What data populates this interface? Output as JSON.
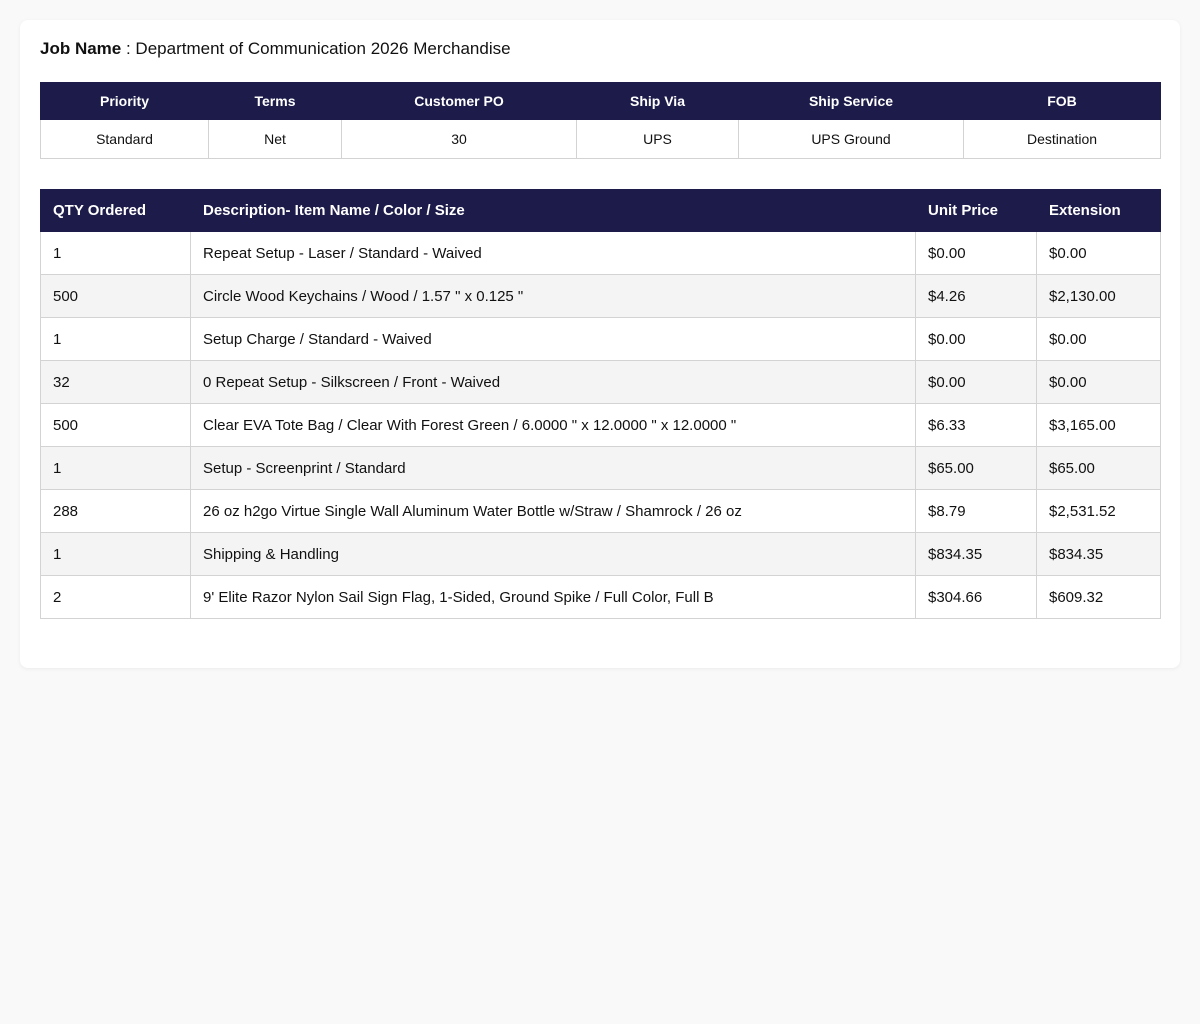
{
  "job": {
    "label": "Job Name",
    "separator": " : ",
    "value": "Department of Communication 2026 Merchandise"
  },
  "info_table": {
    "headers": [
      "Priority",
      "Terms",
      "Customer PO",
      "Ship Via",
      "Ship Service",
      "FOB"
    ],
    "values": [
      "Standard",
      "Net",
      "30",
      "UPS",
      "UPS Ground",
      "Destination"
    ]
  },
  "items_table": {
    "headers": [
      "QTY Ordered",
      "Description- Item Name / Color / Size",
      "Unit Price",
      "Extension"
    ],
    "rows": [
      [
        "1",
        "Repeat Setup - Laser / Standard - Waived",
        "$0.00",
        "$0.00"
      ],
      [
        "500",
        "Circle Wood Keychains / Wood / 1.57 \" x 0.125 \"",
        "$4.26",
        "$2,130.00"
      ],
      [
        "1",
        "Setup Charge / Standard - Waived",
        "$0.00",
        "$0.00"
      ],
      [
        "32",
        "0 Repeat Setup - Silkscreen / Front - Waived",
        "$0.00",
        "$0.00"
      ],
      [
        "500",
        "Clear EVA Tote Bag / Clear With Forest Green / 6.0000 \" x 12.0000 \" x 12.0000 \"",
        "$6.33",
        "$3,165.00"
      ],
      [
        "1",
        "Setup - Screenprint / Standard",
        "$65.00",
        "$65.00"
      ],
      [
        "288",
        "26 oz h2go Virtue Single Wall Aluminum Water Bottle w/Straw / Shamrock / 26 oz",
        "$8.79",
        "$2,531.52"
      ],
      [
        "1",
        "Shipping & Handling",
        "$834.35",
        "$834.35"
      ],
      [
        "2",
        "9' Elite Razor Nylon Sail Sign Flag, 1-Sided, Ground Spike / Full Color, Full B",
        "$304.66",
        "$609.32"
      ]
    ]
  },
  "colors": {
    "header_bg": "#1c1b4a",
    "header_text": "#ffffff",
    "row_alt_bg": "#f4f4f4",
    "border": "#d3d3d3"
  }
}
